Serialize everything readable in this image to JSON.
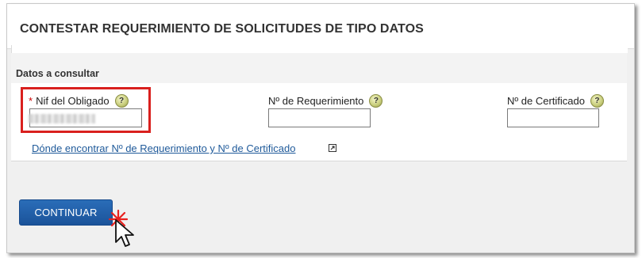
{
  "page": {
    "title": "CONTESTAR REQUERIMIENTO DE SOLICITUDES DE TIPO DATOS"
  },
  "form": {
    "section_label": "Datos a consultar",
    "fields": [
      {
        "label": "Nif del Obligado",
        "required_marker": "*",
        "help": "?",
        "value": ""
      },
      {
        "label": "Nº de Requerimiento",
        "help": "?",
        "value": ""
      },
      {
        "label": "Nº de Certificado",
        "help": "?",
        "value": ""
      }
    ],
    "help_link": "Dónde encontrar Nº de Requerimiento y Nº de Certificado"
  },
  "actions": {
    "continue_label": "CONTINUAR"
  },
  "colors": {
    "accent": "#1f5a9a",
    "button": "#2262aa",
    "highlight": "#d9201e",
    "required": "#cc0000"
  },
  "icons": [
    "help-icon",
    "external-link-icon",
    "click-star-icon",
    "hand-cursor-icon"
  ]
}
